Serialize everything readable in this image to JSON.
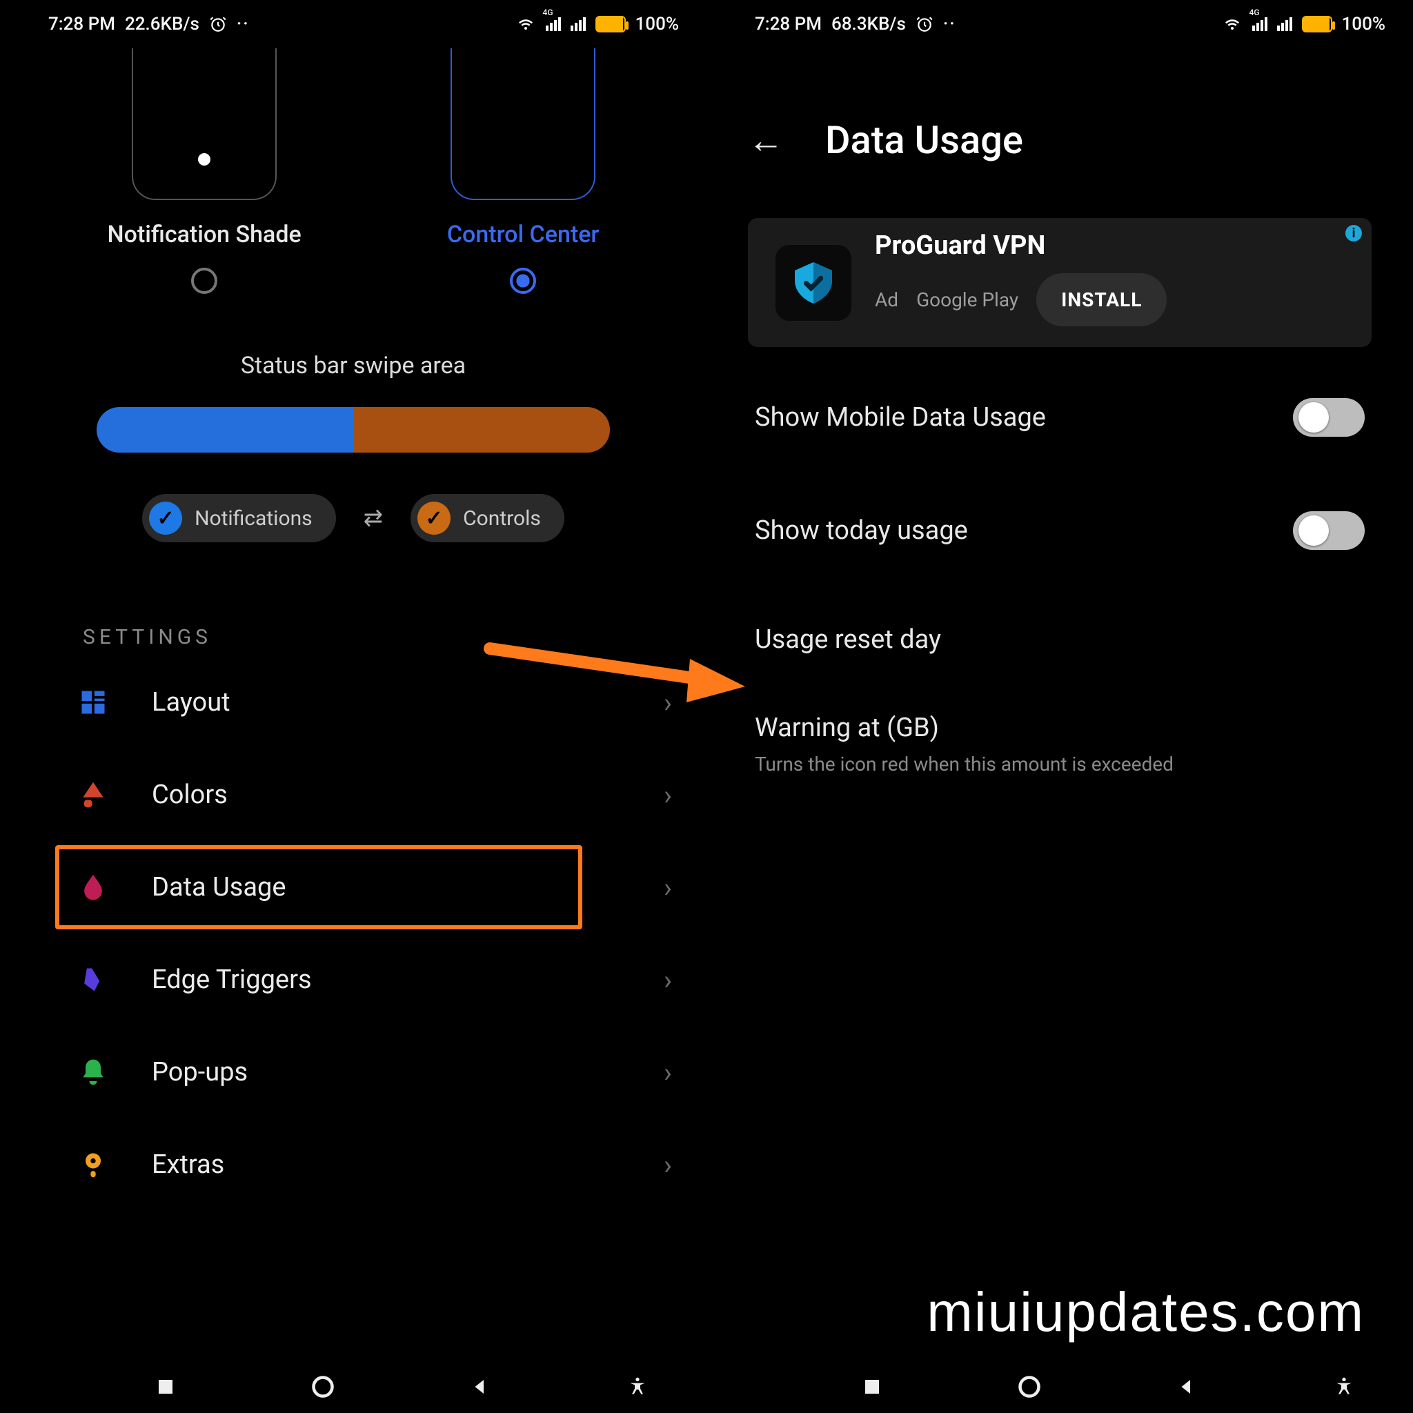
{
  "left": {
    "status": {
      "time": "7:28 PM",
      "net_speed": "22.6KB/s",
      "battery_pct": "100%"
    },
    "styles": {
      "notification_shade": "Notification Shade",
      "control_center": "Control Center"
    },
    "swipe_title": "Status bar swipe area",
    "chips": {
      "notifications": "Notifications",
      "controls": "Controls"
    },
    "section_label": "SETTINGS",
    "items": [
      {
        "label": "Layout"
      },
      {
        "label": "Colors"
      },
      {
        "label": "Data Usage"
      },
      {
        "label": "Edge Triggers"
      },
      {
        "label": "Pop-ups"
      },
      {
        "label": "Extras"
      }
    ]
  },
  "right": {
    "status": {
      "time": "7:28 PM",
      "net_speed": "68.3KB/s",
      "battery_pct": "100%"
    },
    "header": "Data Usage",
    "ad": {
      "title": "ProGuard VPN",
      "tag": "Ad",
      "source": "Google Play",
      "cta": "INSTALL"
    },
    "prefs": {
      "show_mobile": "Show Mobile Data Usage",
      "show_today": "Show today usage",
      "reset_day": "Usage reset day",
      "warning_title": "Warning at (GB)",
      "warning_sub": "Turns the icon red when this amount is exceeded"
    }
  },
  "watermark": "miuiupdates.com"
}
